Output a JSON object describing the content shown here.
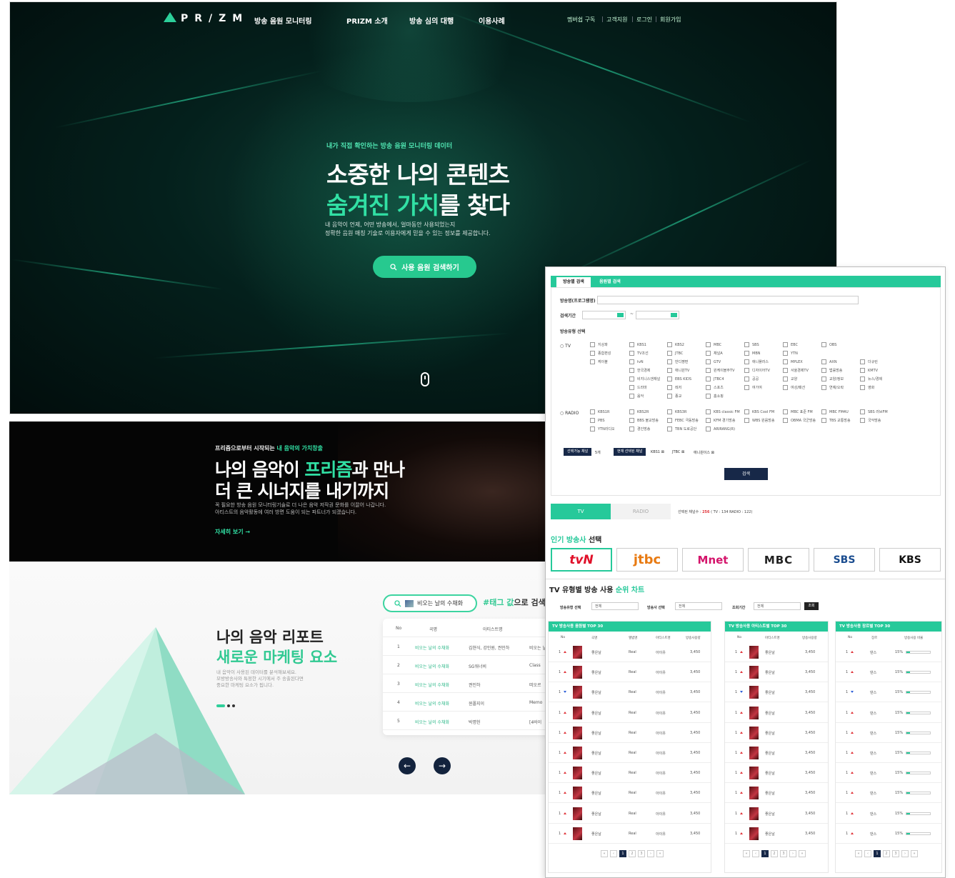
{
  "nav": {
    "logo": "PR/ZM",
    "items": [
      "방송 음원 모니터링",
      "PRIZM 소개",
      "방송 심의 대행",
      "이용사례"
    ],
    "top_links": [
      "멤버쉽 구독",
      "고객지원",
      "로그인",
      "회원가입"
    ]
  },
  "hero": {
    "kicker": "내가 직접 확인하는 방송 음원 모니터링 데이터",
    "title_line1": "소중한 나의 콘텐츠",
    "title_line2_green": "숨겨진 가치",
    "title_line2_rest": "를 찾다",
    "desc_line1": "내 음악이 언제, 어떤 방송에서, 얼마동안 사용되었는지",
    "desc_line2": "정확한 음원 매칭 기술로 이용자에게 믿을 수 있는 정보를 제공합니다.",
    "button": "사용 음원 검색하기"
  },
  "section2": {
    "kicker_prefix": "프리즘으로부터 시작되는 ",
    "kicker_green": "내 음악의 가치창출",
    "title_line1_a": "나의 음악이 ",
    "title_line1_green": "프리즘",
    "title_line1_b": "과 만나",
    "title_line2": "더 큰 시너지를 내기까지",
    "desc_line1": "꼭 필요한 방송 음원 모니터링기술로 더 나은 음악 저작권 문화를 이끌어 나갑니다.",
    "desc_line2": "아티스트의 음악활동에 여러 방면 도움이 되는 파트너가 되겠습니다.",
    "more": "자세히 보기 →"
  },
  "section3": {
    "title1": "나의 음악 리포트",
    "title2": "새로운 마케팅 요소",
    "desc_line1": "내 음악이 사용된 데이터를 분석해보세요.",
    "desc_line2": "모방방송사와 특정한 시기에서 주 송출된다면",
    "desc_line3": "중요한 마케팅 요소가 됩니다.",
    "search_text": "비오는 날의 수채화",
    "tagline_green": "#태그 값",
    "tagline_rest": "으로 검색하",
    "table_headers": [
      "No",
      "곡명",
      "아티스트명"
    ],
    "rows": [
      {
        "no": "1",
        "song": "비오는 날의 수채화",
        "artist": "김현식, 강인원, 권인하",
        "extra": "비오는 날"
      },
      {
        "no": "2",
        "song": "비오는 날의 수채화",
        "artist": "SG워너비",
        "extra": "Class"
      },
      {
        "no": "3",
        "song": "비오는 날의 수채화",
        "artist": "권인하",
        "extra": "떠오르"
      },
      {
        "no": "4",
        "song": "비오는 날의 수채화",
        "artist": "윈폴지이",
        "extra": "Memo"
      },
      {
        "no": "5",
        "song": "비오는 날의 수채화",
        "artist": "박명헌",
        "extra": "[4바이"
      }
    ],
    "prev": "←",
    "next": "→"
  },
  "panel": {
    "tabs": [
      "방송별 검색",
      "음원별 검색"
    ],
    "label_program": "방송명(프로그램명)",
    "label_period": "검색기간",
    "label_type": "방송유형 선택",
    "period_sep": "~",
    "tv_label": "TV",
    "radio_label": "RADIO",
    "tv_types": [
      "지상파",
      "종합편성",
      "케이블"
    ],
    "tv_channels": [
      [
        "KBS1",
        "KBS2",
        "MBC",
        "SBS",
        "EBC",
        "OBS"
      ],
      [
        "TV조선",
        "JTBC",
        "채널A",
        "MBN",
        "YTN"
      ],
      [
        "tvN",
        "반디쨩편",
        "GTV",
        "애니플러스",
        "MPLEX",
        "AXN",
        "더규린"
      ],
      [
        "한국경제",
        "애니원TV",
        "원케이블주TV",
        "디자이어TV",
        "서울경제TV",
        "법률방송",
        "KMTV"
      ],
      [
        "비지니스앤채널",
        "EBS KIDS",
        "JTBC4",
        "공공",
        "교양",
        "교양/정보",
        "뉴스/경제"
      ],
      [
        "드라마",
        "레저",
        "스포츠",
        "여가여",
        "여성/패션",
        "연예/오락",
        "영화"
      ],
      [
        "음악",
        "종교",
        "홈쇼핑"
      ]
    ],
    "radio_channels": [
      [
        "KBS1R",
        "KBS2R",
        "KBS3R",
        "KBS classic FM",
        "KBS Cool FM",
        "MBC 표준 FM",
        "MBC FM4U",
        "SBS 러브FM"
      ],
      [
        "PBS",
        "BBS 불교방송",
        "FEBC 극동방송",
        "KFM 경기방송",
        "WBS 원음방송",
        "OBMA 국군방송",
        "TBS 교통방송",
        "국악방송"
      ],
      [
        "YTN라디오",
        "경인방송",
        "TBN 도로공단",
        "ARIRANG(R)"
      ]
    ],
    "chip_available": "선택가능 채널",
    "chip_available_count": "5개",
    "chip_selected": "현재 선택된 채널",
    "selected": [
      "KBS1 ⊠",
      "JTBC ⊠",
      "애니원이스 ⊠"
    ],
    "search_btn": "검색",
    "tv_tab": "TV",
    "radio_tab": "RADIO",
    "channel_count_prefix": "선택된 채널수 : ",
    "channel_count_total": "256",
    "channel_count_rest": " ( TV : 134  RADIO : 122)",
    "popular_title_green": "인기 방송사",
    "popular_title_rest": " 선택",
    "brands": [
      "tvN",
      "jtbc",
      "Mnet",
      "MBC",
      "SBS",
      "KBS"
    ],
    "chart_title_a": "TV 유형별 방송 사용 ",
    "chart_title_green": "순위 차트",
    "filter_type_label": "방송유형 선택",
    "filter_station_label": "방송사 선택",
    "filter_period_label": "조회기간",
    "filter_all": "전체",
    "filter_btn": "조회",
    "chart1_title": "TV 방송사용 음원별 TOP 30",
    "chart2_title": "TV 방송사용 아티스트별 TOP 30",
    "chart3_title": "TV 방송사용 장르별 TOP 30",
    "chart1_cols": [
      "No",
      "곡명",
      "앨범명",
      "아티스트명",
      "방송사용량"
    ],
    "chart2_cols": [
      "No",
      "아티스트명",
      "방송사용량"
    ],
    "chart3_cols": [
      "No",
      "장르",
      "방송사용 비율"
    ],
    "row_rank": "1",
    "row_song": "좋은날",
    "row_album": "Real",
    "row_artist": "아이유",
    "row_count": "3,450",
    "row_genre": "댄스",
    "row_percent": "15%",
    "row_percent_value": 0.15,
    "pages": [
      "«",
      "‹",
      "1",
      "2",
      "3",
      "›",
      "»"
    ]
  }
}
